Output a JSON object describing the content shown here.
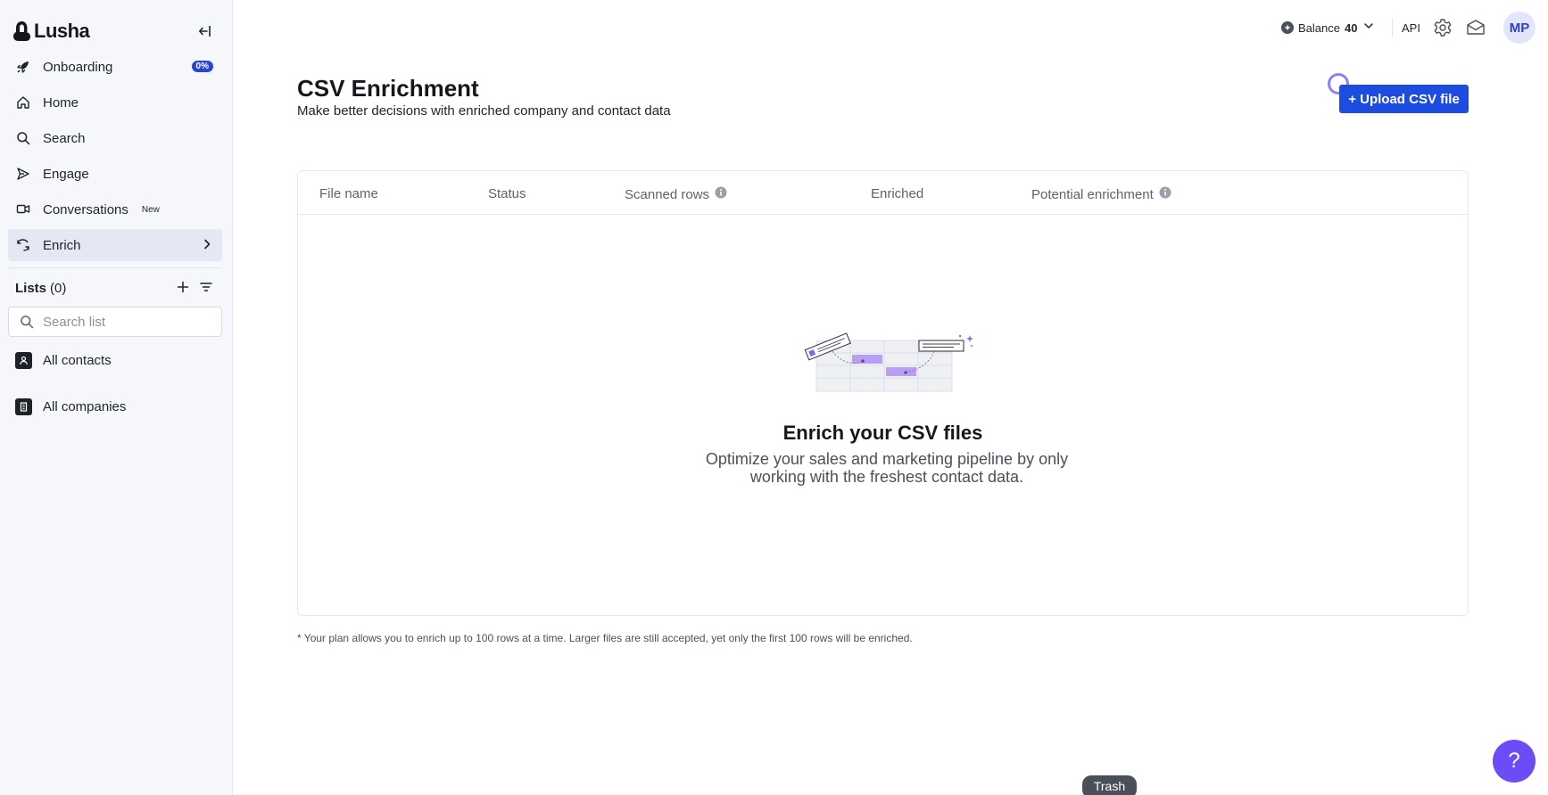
{
  "brand": {
    "name": "Lusha"
  },
  "sidebar": {
    "items": [
      {
        "label": "Onboarding",
        "icon": "rocket-icon",
        "badge": "0%"
      },
      {
        "label": "Home",
        "icon": "home-icon"
      },
      {
        "label": "Search",
        "icon": "search-icon"
      },
      {
        "label": "Engage",
        "icon": "send-icon"
      },
      {
        "label": "Conversations",
        "icon": "chat-icon",
        "badge": "New"
      },
      {
        "label": "Enrich",
        "icon": "refresh-icon",
        "active": true
      }
    ],
    "lists": {
      "title": "Lists",
      "count": "(0)",
      "search_placeholder": "Search list",
      "entries": [
        {
          "label": "All contacts",
          "icon": "contact-icon"
        },
        {
          "label": "All companies",
          "icon": "building-icon"
        }
      ]
    }
  },
  "topbar": {
    "balance_label": "Balance",
    "balance_value": "40",
    "api_label": "API",
    "avatar_initials": "MP"
  },
  "main": {
    "title": "CSV Enrichment",
    "subtitle": "Make better decisions with enriched company and contact data",
    "upload_label": "+ Upload CSV file",
    "table": {
      "columns": [
        "File name",
        "Status",
        "Scanned rows",
        "Enriched",
        "Potential enrichment"
      ]
    },
    "empty": {
      "title": "Enrich your CSV files",
      "text": "Optimize your sales and marketing pipeline by only working with the freshest contact data."
    },
    "footnote": "* Your plan allows you to enrich up to 100 rows at a time. Larger files are still accepted, yet only the first 100 rows will be enriched."
  },
  "trash_label": "Trash",
  "help_label": "?",
  "colors": {
    "accent": "#1d4ce0",
    "help": "#6b4cf6",
    "badge": "#2c43d6"
  }
}
